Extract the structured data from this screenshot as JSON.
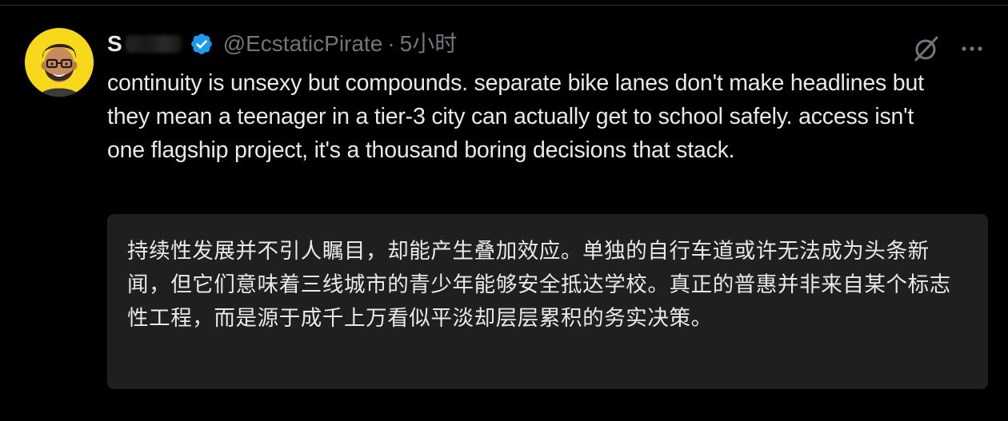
{
  "tweet": {
    "author": {
      "display_name_visible": "S",
      "handle": "@EcstaticPirate",
      "verified": true,
      "avatar": "avatar-cartoon-man-glasses"
    },
    "separator": "·",
    "time": "5小时",
    "text": "continuity is unsexy but compounds. separate bike lanes don't make headlines but they mean a teenager in a tier-3 city can actually get to school safely. access isn't one flagship project, it's a thousand boring decisions that stack.",
    "translation": "持续性发展并不引人瞩目，却能产生叠加效应。单独的自行车道或许无法成为头条新闻，但它们意味着三线城市的青少年能够安全抵达学校。真正的普惠并非来自某个标志性工程，而是源于成千上万看似平淡却层层累积的务实决策。"
  },
  "icons": {
    "verified": "verified-badge-icon",
    "grok": "grok-icon",
    "more": "more-options-icon"
  },
  "colors": {
    "background": "#000000",
    "text_primary": "#e7e9ea",
    "text_secondary": "#71767b",
    "verified_blue": "#1d9bf0",
    "translation_bg": "#1f1f1f",
    "avatar_bg": "#f7d81b"
  }
}
